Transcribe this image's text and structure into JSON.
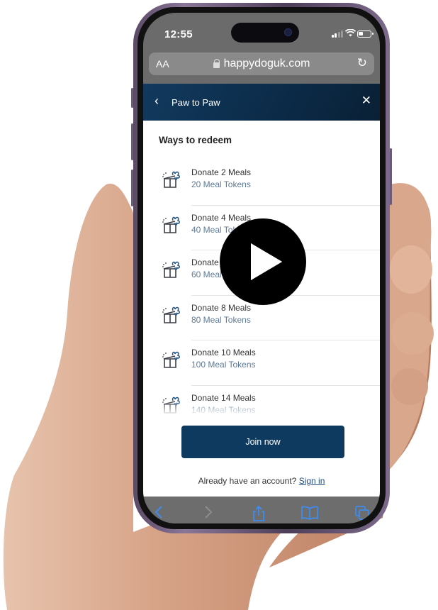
{
  "status_bar": {
    "time": "12:55"
  },
  "browser": {
    "text_size_label": "AA",
    "url": "happydoguk.com",
    "icons": {
      "lock": "lock-icon",
      "reload": "reload-icon"
    }
  },
  "app_header": {
    "title": "Paw to Paw",
    "back_icon": "chevron-left-icon",
    "close_icon": "close-icon"
  },
  "content": {
    "section_title": "Ways to redeem",
    "redeem_options": [
      {
        "title": "Donate 2 Meals",
        "cost": "20 Meal Tokens",
        "icon": "gift-icon"
      },
      {
        "title": "Donate 4 Meals",
        "cost": "40 Meal Tokens",
        "icon": "gift-icon"
      },
      {
        "title": "Donate 6 Meals",
        "cost": "60 Meal Tokens",
        "icon": "gift-icon"
      },
      {
        "title": "Donate 8 Meals",
        "cost": "80 Meal Tokens",
        "icon": "gift-icon"
      },
      {
        "title": "Donate 10 Meals",
        "cost": "100 Meal Tokens",
        "icon": "gift-icon"
      },
      {
        "title": "Donate 14 Meals",
        "cost": "140 Meal Tokens",
        "icon": "gift-icon"
      }
    ],
    "join_button_label": "Join now",
    "account_prompt": "Already have an account?",
    "sign_in_label": "Sign in"
  },
  "safari_toolbar": {
    "back": "chevron-left-icon",
    "forward": "chevron-right-icon",
    "share": "share-icon",
    "bookmarks": "book-icon",
    "tabs": "tabs-icon"
  },
  "overlay": {
    "play_icon": "play-icon"
  },
  "colors": {
    "brand_navy": "#0e3a5f",
    "token_text": "#5d7a9a",
    "safari_blue": "#3d8cf0"
  }
}
